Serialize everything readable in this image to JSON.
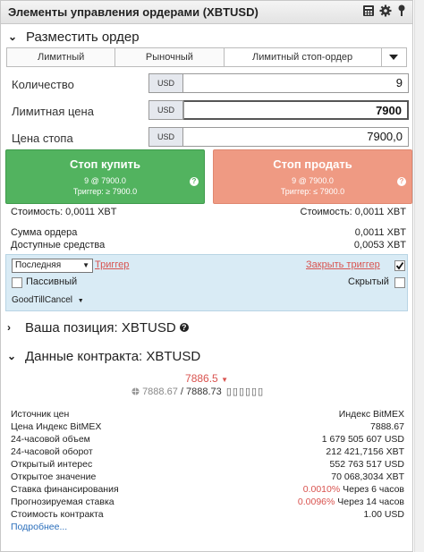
{
  "title": "Элементы управления ордерами (XBTUSD)",
  "place_order": {
    "heading": "Разместить ордер",
    "tabs": [
      "Лимитный",
      "Рыночный",
      "Лимитный стоп-ордер"
    ],
    "fields": [
      {
        "label": "Количество",
        "unit": "USD",
        "value": "9"
      },
      {
        "label": "Лимитная цена",
        "unit": "USD",
        "value": "7900"
      },
      {
        "label": "Цена стопа",
        "unit": "USD",
        "value": "7900,0"
      }
    ],
    "buy": {
      "label": "Стоп купить",
      "line1": "9 @ 7900.0",
      "line2": "Триггер: ≥ 7900.0",
      "help": "?"
    },
    "sell": {
      "label": "Стоп продать",
      "line1": "9 @ 7900.0",
      "line2": "Триггер: ≤ 7900.0",
      "help": "?"
    },
    "cost_buy": "Стоимость: 0,0011 XBT",
    "cost_sell": "Стоимость: 0,0011 XBT",
    "order_sum_label": "Сумма ордера",
    "order_sum_value": "0,0011 XBT",
    "available_label": "Доступные средства",
    "available_value": "0,0053 XBT",
    "trigger_type": "Последняя",
    "trigger_link": "Триггер",
    "close_trigger": "Закрыть триггер",
    "passive_label": "Пассивный",
    "hidden_label": "Скрытый",
    "tif": "GoodTillCancel"
  },
  "position": {
    "heading": "Ваша позиция: XBTUSD"
  },
  "contract": {
    "heading": "Данные контракта: XBTUSD",
    "last_price": "7886.5",
    "bid_ask_left": "7888.67",
    "bid_ask_right": "7888.73",
    "rows": [
      {
        "k": "Источник цен",
        "v": "Индекс BitMEX"
      },
      {
        "k": "Цена Индекс BitMEX",
        "v": "7888.67"
      },
      {
        "k": "24-часовой объем",
        "v": "1 679 505 607 USD"
      },
      {
        "k": "24-часовой оборот",
        "v": "212 421,7156 XBT"
      },
      {
        "k": "Открытый интерес",
        "v": "552 763 517 USD"
      },
      {
        "k": "Открытое значение",
        "v": "70 068,3034 XBT"
      },
      {
        "k": "Ставка финансирования",
        "v_red": "0.0010%",
        "v": "Через 6 часов"
      },
      {
        "k": "Прогнозируемая ставка",
        "v_red": "0.0096%",
        "v": "Через 14 часов"
      },
      {
        "k": "Стоимость контракта",
        "v": "1.00 USD"
      }
    ],
    "more_link": "Подробнее..."
  },
  "colors": {
    "buy": "#52b35f",
    "sell": "#ef9a83",
    "accent_red": "#d9534f",
    "options_bg": "#d9ebf5"
  }
}
